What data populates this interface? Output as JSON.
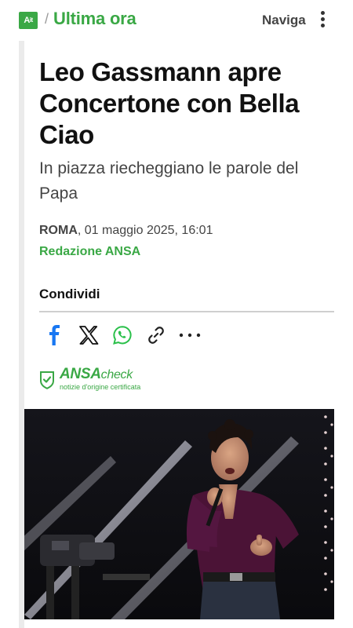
{
  "header": {
    "logo_text": "A",
    "separator": "/",
    "section": "Ultima ora",
    "nav_label": "Naviga"
  },
  "article": {
    "headline": "Leo Gassmann apre Concertone con Bella Ciao",
    "subtitle": "In piazza riecheggiano le parole del Papa",
    "location": "ROMA",
    "date": ", 01 maggio 2025, 16:01",
    "author": "Redazione ANSA"
  },
  "share": {
    "title": "Condividi",
    "buttons": [
      {
        "icon": "facebook-icon",
        "color": "#1877f2"
      },
      {
        "icon": "x-icon",
        "color": "#111111"
      },
      {
        "icon": "whatsapp-icon",
        "color": "#2ac04a"
      },
      {
        "icon": "link-icon",
        "color": "#222222"
      },
      {
        "icon": "more-icon",
        "color": "#222222"
      }
    ]
  },
  "ansa_check": {
    "brand": "ANSA",
    "suffix": "check",
    "tagline": "notizie d'origine certificata"
  },
  "colors": {
    "brand_green": "#3aa845",
    "text_dark": "#111111",
    "text_muted": "#444444"
  }
}
